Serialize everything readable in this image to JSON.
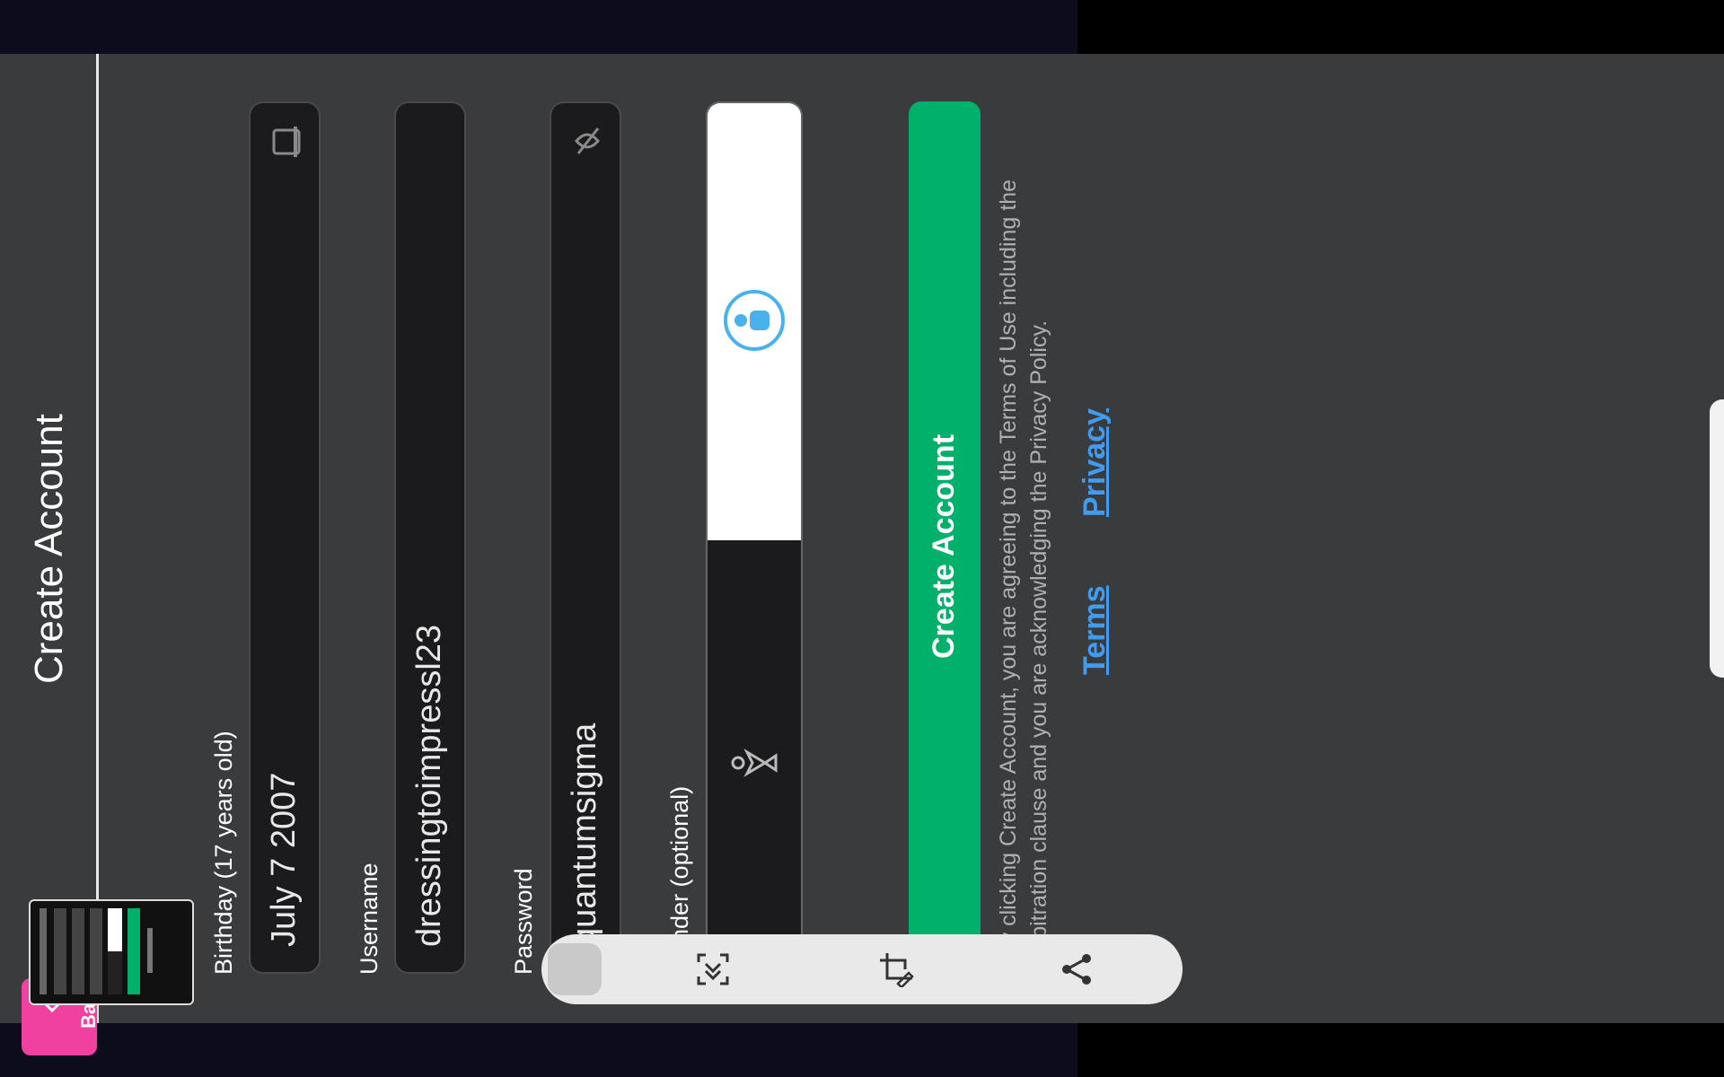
{
  "page": {
    "title": "Create Account"
  },
  "form": {
    "birthday_label": "Birthday (17 years old)",
    "birthday_value": "July 7 2007",
    "username_label": "Username",
    "username_value": "dressingtoimpressl23",
    "password_label": "Password",
    "password_value": "quantumsigma",
    "gender_label": "Gender (optional)",
    "submit_label": "Create Account",
    "legal_text": "By clicking Create Account, you are agreeing to the Terms of Use including the arbitration clause and you are acknowledging the Privacy Policy.",
    "terms_link": "Terms",
    "privacy_link": "Privacy"
  },
  "back_button": {
    "label": "Bac"
  },
  "colors": {
    "background": "#393b3d",
    "field_bg": "#1b1b1d",
    "primary": "#00b06b",
    "link": "#3f9cf0",
    "back_button": "#f040a0"
  },
  "toolbar": {
    "icons": [
      "thumbnail-icon",
      "scroll-capture-icon",
      "crop-edit-icon",
      "share-icon"
    ]
  }
}
